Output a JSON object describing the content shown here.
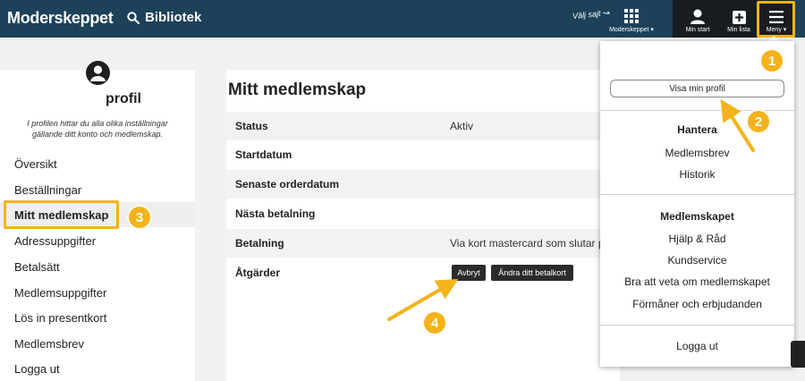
{
  "header": {
    "logo": "Moderskeppet",
    "library_label": "Bibliotek",
    "choose_site": "Välj sajt ↝",
    "nav": {
      "moderskeppet": "Moderskeppet ▾",
      "min_start": "Min start",
      "min_lista": "Min lista",
      "meny": "Meny ▾"
    }
  },
  "sidebar": {
    "title": "profil",
    "description": "I profilen hittar du alla olika inställningar gällande ditt konto och medlemskap.",
    "items": [
      {
        "label": "Översikt"
      },
      {
        "label": "Beställningar"
      },
      {
        "label": "Mitt medlemskap"
      },
      {
        "label": "Adressuppgifter"
      },
      {
        "label": "Betalsätt"
      },
      {
        "label": "Medlemsuppgifter"
      },
      {
        "label": "Lös in presentkort"
      },
      {
        "label": "Medlemsbrev"
      },
      {
        "label": "Logga ut"
      }
    ]
  },
  "main": {
    "title": "Mitt medlemskap",
    "rows": [
      {
        "key": "Status",
        "value": "Aktiv"
      },
      {
        "key": "Startdatum",
        "value": ""
      },
      {
        "key": "Senaste orderdatum",
        "value": ""
      },
      {
        "key": "Nästa betalning",
        "value": ""
      },
      {
        "key": "Betalning",
        "value": "Via kort mastercard som slutar p"
      },
      {
        "key": "Åtgärder",
        "value": ""
      }
    ],
    "cancel_button": "Avbryt",
    "change_card_button": "Ändra ditt betalkort"
  },
  "dropdown": {
    "profile_button": "Visa min profil",
    "section1": {
      "heading": "Hantera",
      "items": [
        "Medlemsbrev",
        "Historik"
      ]
    },
    "section2": {
      "heading": "Medlemskapet",
      "items": [
        "Hjälp & Råd",
        "Kundservice",
        "Bra att veta om medlemskapet",
        "Förmåner och erbjudanden"
      ]
    },
    "logout": "Logga ut"
  },
  "callouts": [
    "1",
    "2",
    "3",
    "4"
  ],
  "colors": {
    "header_bg": "#1d4159",
    "accent": "#f4b31a",
    "nav_dark": "#181d22"
  }
}
